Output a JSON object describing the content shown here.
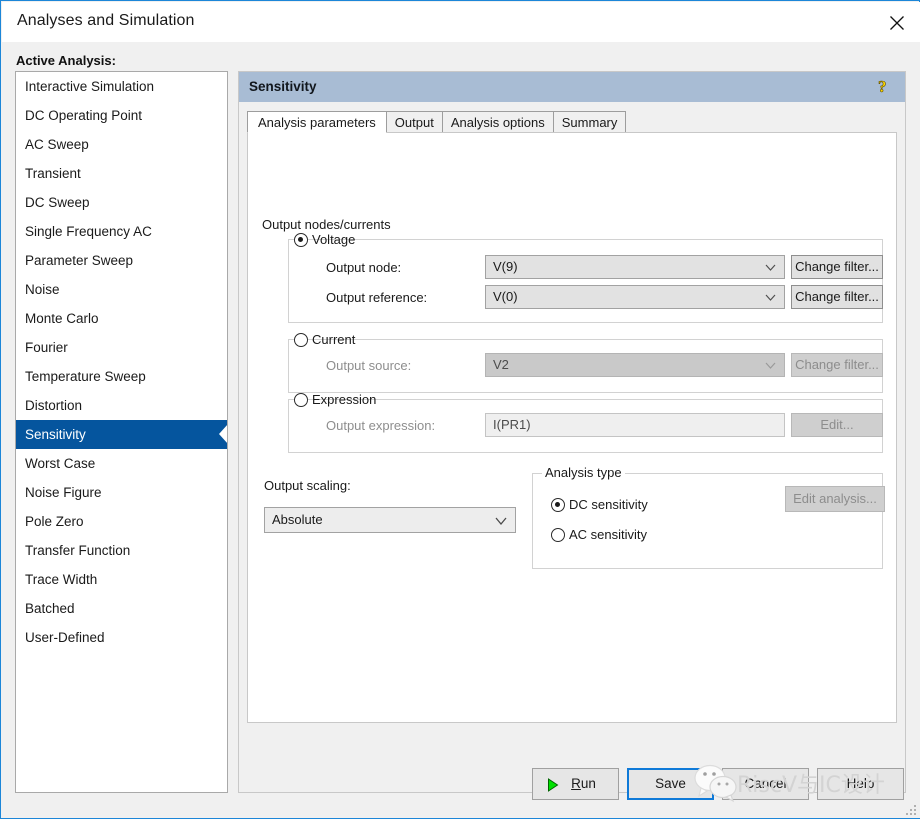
{
  "window": {
    "title": "Analyses and Simulation",
    "close_icon": "close-icon"
  },
  "sidebar": {
    "heading": "Active Analysis:",
    "selected": "Sensitivity",
    "items": [
      {
        "label": "Interactive Simulation"
      },
      {
        "label": "DC Operating Point"
      },
      {
        "label": "AC Sweep"
      },
      {
        "label": "Transient"
      },
      {
        "label": "DC Sweep"
      },
      {
        "label": "Single Frequency AC"
      },
      {
        "label": "Parameter Sweep"
      },
      {
        "label": "Noise"
      },
      {
        "label": "Monte Carlo"
      },
      {
        "label": "Fourier"
      },
      {
        "label": "Temperature Sweep"
      },
      {
        "label": "Distortion"
      },
      {
        "label": "Sensitivity"
      },
      {
        "label": "Worst Case"
      },
      {
        "label": "Noise Figure"
      },
      {
        "label": "Pole Zero"
      },
      {
        "label": "Transfer Function"
      },
      {
        "label": "Trace Width"
      },
      {
        "label": "Batched"
      },
      {
        "label": "User-Defined"
      }
    ]
  },
  "panel": {
    "header_title": "Sensitivity",
    "help_icon": "help-question-icon",
    "tabs": [
      {
        "label": "Analysis parameters",
        "active": true
      },
      {
        "label": "Output",
        "active": false
      },
      {
        "label": "Analysis options",
        "active": false
      },
      {
        "label": "Summary",
        "active": false
      }
    ]
  },
  "output_nodes": {
    "section_label": "Output nodes/currents",
    "voltage": {
      "radio_label": "Voltage",
      "checked": true,
      "node_label": "Output node:",
      "node_value": "V(9)",
      "node_button": "Change filter...",
      "reference_label": "Output reference:",
      "reference_value": "V(0)",
      "reference_button": "Change filter..."
    },
    "current": {
      "radio_label": "Current",
      "checked": false,
      "source_label": "Output source:",
      "source_value": "V2",
      "source_button": "Change filter..."
    },
    "expression": {
      "radio_label": "Expression",
      "checked": false,
      "expression_label": "Output expression:",
      "expression_value": "I(PR1)",
      "edit_button": "Edit..."
    }
  },
  "output_scaling": {
    "label": "Output scaling:",
    "value": "Absolute"
  },
  "analysis_type": {
    "group_title": "Analysis type",
    "options": [
      {
        "label": "DC sensitivity",
        "checked": true
      },
      {
        "label": "AC sensitivity",
        "checked": false
      }
    ],
    "edit_button": "Edit analysis..."
  },
  "footer": {
    "run": {
      "prefix": "R",
      "rest": "un",
      "icon": "play-triangle-icon"
    },
    "save": "Save",
    "cancel": "Cancel",
    "help": "Help"
  },
  "watermark": {
    "text": "RiscV与IC设计",
    "logo": "wechat-logo"
  },
  "colors": {
    "window_border": "#1c86d8",
    "panel_header": "#a8bcd4",
    "selection": "#05559e",
    "focus_border": "#0f7ad8",
    "run_triangle": "#00d000",
    "help_yellow": "#ffd800"
  }
}
